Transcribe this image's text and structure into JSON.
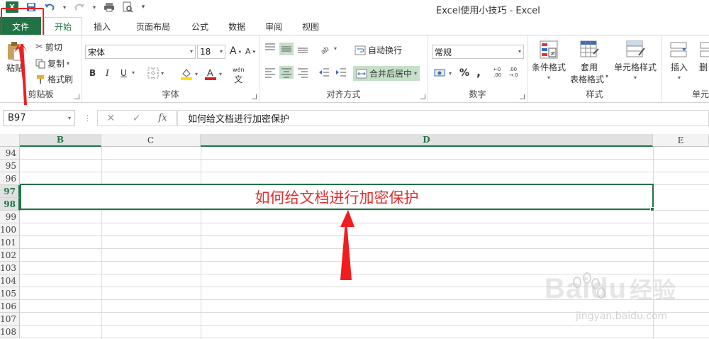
{
  "window": {
    "title": "Excel使用小技巧 - Excel"
  },
  "qat": {
    "app_icon": "excel-logo",
    "save": "save-icon",
    "undo": "undo-icon",
    "redo": "redo-icon",
    "print_preview": "print-icon",
    "customize": "customize-icon",
    "app_label": "X"
  },
  "tabs": [
    {
      "label": "文件"
    },
    {
      "label": "开始"
    },
    {
      "label": "插入"
    },
    {
      "label": "页面布局"
    },
    {
      "label": "公式"
    },
    {
      "label": "数据"
    },
    {
      "label": "审阅"
    },
    {
      "label": "视图"
    }
  ],
  "ribbon": {
    "clipboard": {
      "label": "剪贴板",
      "paste": "粘贴",
      "cut": "剪切",
      "copy": "复制",
      "format_painter": "格式刷"
    },
    "font": {
      "label": "字体",
      "font_name": "宋体",
      "font_size": "18",
      "grow": "A",
      "shrink": "A",
      "bold": "B",
      "italic": "I",
      "underline": "U",
      "phonetic": "wén"
    },
    "alignment": {
      "label": "对齐方式",
      "wrap_text": "自动换行",
      "merge_center": "合并后居中"
    },
    "number": {
      "label": "数字",
      "format": "常规",
      "percent": "%",
      "comma": ","
    },
    "styles": {
      "label": "样式",
      "conditional": "条件格式",
      "table_format_1": "套用",
      "table_format_2": "表格格式",
      "cell_styles": "单元格样式"
    },
    "cells": {
      "label": "单元",
      "insert": "插入",
      "delete": "删"
    }
  },
  "formula_bar": {
    "name_box": "B97",
    "cancel": "✕",
    "enter": "✓",
    "fx": "fx",
    "value": "如何给文档进行加密保护"
  },
  "sheet": {
    "columns": [
      "B",
      "C",
      "D",
      "E"
    ],
    "rows": [
      "94",
      "95",
      "96",
      "97",
      "98",
      "99",
      "100",
      "101",
      "102",
      "103",
      "104",
      "105",
      "106",
      "107",
      "108"
    ],
    "merged_cell_text": "如何给文档进行加密保护",
    "accent_color": "#217346",
    "text_color": "#e03030"
  },
  "watermark": {
    "brand": "Bai",
    "brand2": "du",
    "cn": "经验",
    "url": "jingyan.baidu.com"
  }
}
